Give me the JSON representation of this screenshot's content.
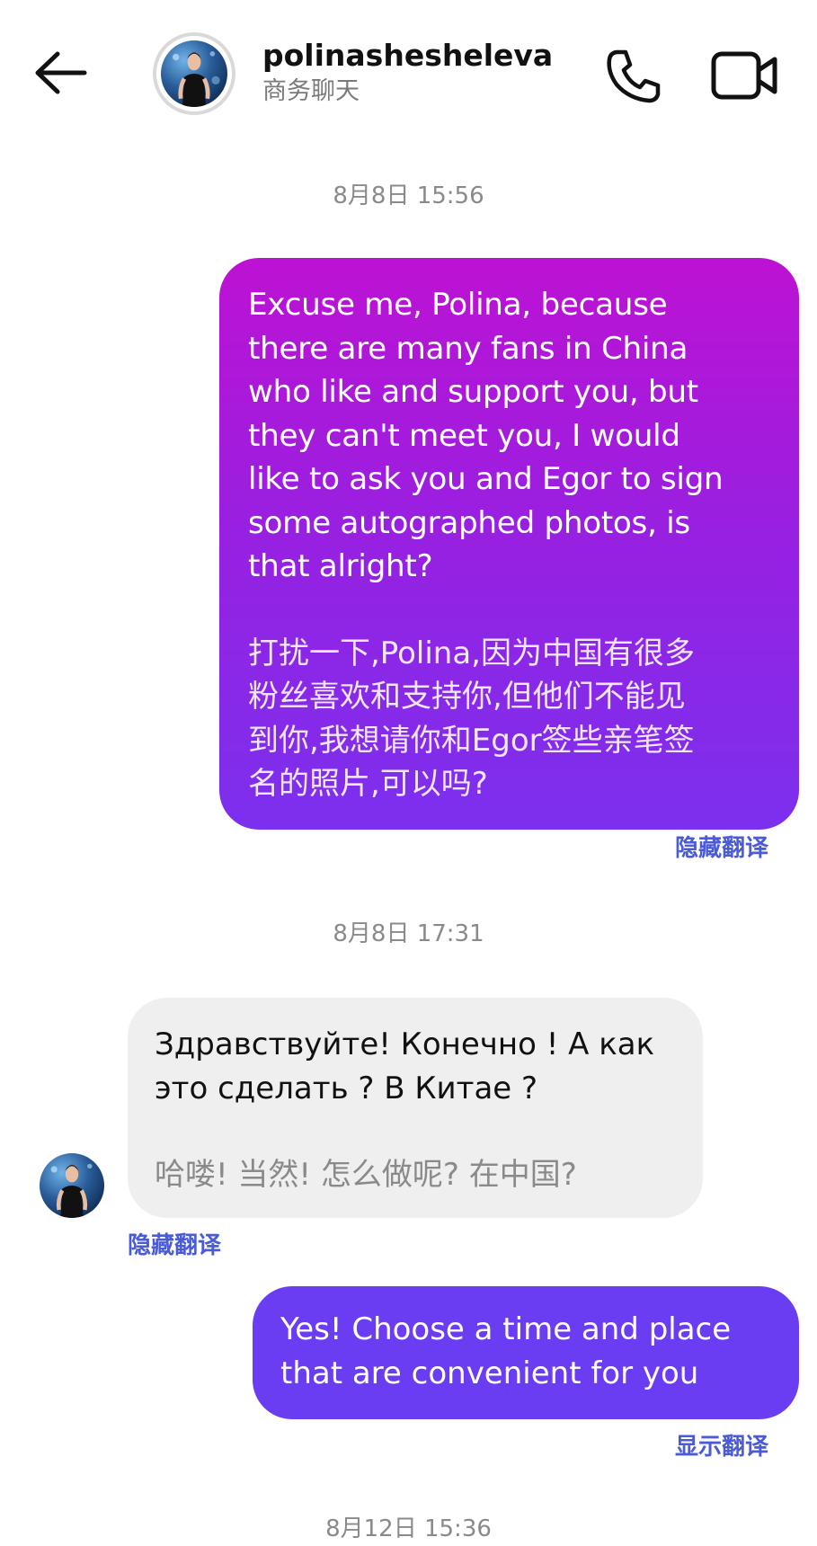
{
  "header": {
    "username": "polinasheshelevа",
    "subtitle": "商务聊天",
    "icons": {
      "back": "back-arrow-icon",
      "call": "phone-icon",
      "video": "video-camera-icon"
    }
  },
  "messages": [
    {
      "timestamp": "8月8日 15:56",
      "direction": "outgoing",
      "text": "Excuse me, Polina, because\nthere are many fans in China\nwho like and support you, but\nthey can't meet you, I would\nlike to ask you and Egor to sign\nsome autographed photos, is\nthat alright?",
      "translation": "打扰一下,Polina,因为中国有很多\n粉丝喜欢和支持你,但他们不能见\n到你,我想请你和Egor签些亲笔签\n名的照片,可以吗?",
      "translate_action": "隐藏翻译"
    },
    {
      "timestamp": "8月8日 17:31",
      "direction": "incoming",
      "text": "Здравствуйте! Конечно ! А как\nэто сделать ? В Китае ?",
      "translation": "哈喽! 当然! 怎么做呢? 在中国?",
      "translate_action": "隐藏翻译"
    },
    {
      "direction": "outgoing",
      "text": "Yes! Choose a time and place\nthat are convenient for you",
      "translate_action": "显示翻译"
    },
    {
      "timestamp": "8月12日 15:36"
    }
  ],
  "colors": {
    "outgoing_gradient_top": "#bd12d3",
    "outgoing_gradient_bottom": "#7b30ee",
    "outgoing_solid": "#6a3cf2",
    "incoming_bg": "#efefef",
    "link": "#4a5bd8"
  }
}
